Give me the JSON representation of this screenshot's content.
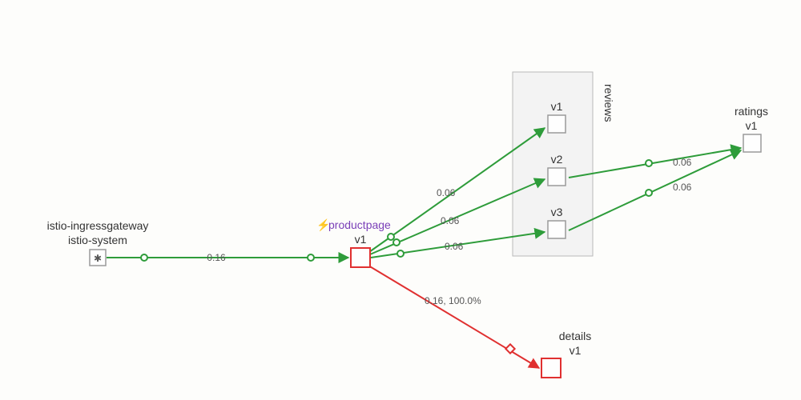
{
  "diagram": {
    "type": "service-mesh-traffic-graph",
    "nodes": {
      "ingress": {
        "title": "istio-ingressgateway",
        "subtitle": "istio-system"
      },
      "productpage": {
        "title": "productpage",
        "version": "v1",
        "bolt": "⚡"
      },
      "reviews": {
        "title": "reviews",
        "versions": {
          "v1": "v1",
          "v2": "v2",
          "v3": "v3"
        }
      },
      "ratings": {
        "title": "ratings",
        "version": "v1"
      },
      "details": {
        "title": "details",
        "version": "v1"
      }
    },
    "edges": {
      "ingress_productpage": {
        "label": "0.16"
      },
      "productpage_reviews_v1": {
        "label": "0.06"
      },
      "productpage_reviews_v2": {
        "label": "0.06"
      },
      "productpage_reviews_v3": {
        "label": "0.06"
      },
      "reviews_v2_ratings": {
        "label": "0.06"
      },
      "reviews_v3_ratings": {
        "label": "0.06"
      },
      "productpage_details": {
        "label": "0.16, 100.0%"
      }
    },
    "colors": {
      "green": "#2e9c3a",
      "red": "#e03030",
      "groupFill": "#f3f3f3",
      "groupStroke": "#b9b9b9",
      "nodeStroke": "#9a9a9a",
      "nodeFill": "#fefefe"
    }
  }
}
